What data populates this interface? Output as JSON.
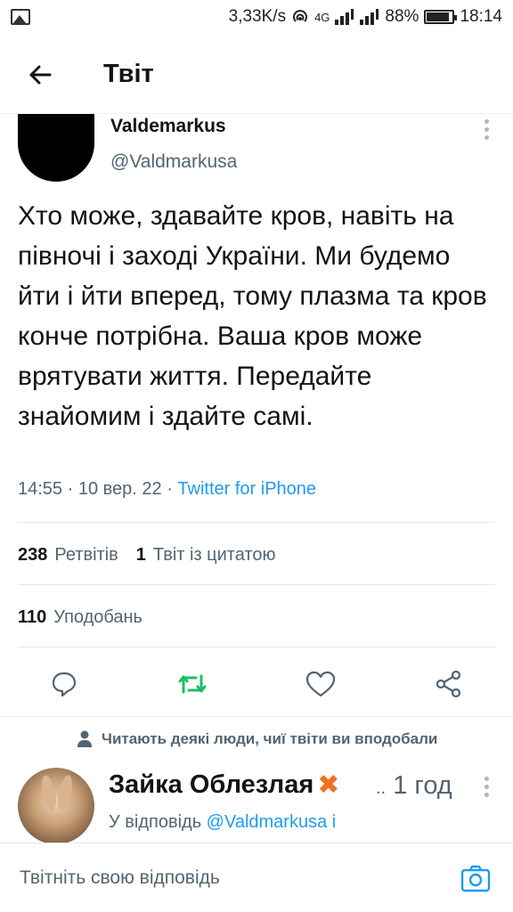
{
  "status_bar": {
    "speed": "3,33K/s",
    "network": "4G",
    "battery": "88%",
    "battery_level": 0.88,
    "time": "18:14"
  },
  "header": {
    "title": "Твіт"
  },
  "tweet": {
    "author_name": "Valdemarkus",
    "author_handle": "@Valdmarkusa",
    "text": "Хто може, здавайте кров, навіть на півночі і заході України. Ми будемо йти і йти вперед, тому плазма та кров конче потрібна. Ваша кров може врятувати життя. Передайте знайомим і здайте самі.",
    "timestamp": "14:55 · 10 вер. 22 · ",
    "source": "Twitter for iPhone",
    "retweets_count": "238",
    "retweets_label": "Ретвітів",
    "quotes_count": "1",
    "quotes_label": "Твіт із цитатою",
    "likes_count": "110",
    "likes_label": "Уподобань"
  },
  "reply_section": {
    "context": "Читають деякі люди, чиї твіти ви вподобали",
    "reply": {
      "author_name": "Зайка Облезлая",
      "author_suffix": "..",
      "time": "1 год",
      "reply_prefix": "У відповідь ",
      "reply_handle": "@Valdmarkusa і"
    }
  },
  "composer": {
    "placeholder": "Твітніть свою відповідь"
  },
  "colors": {
    "accent": "#1d9bf0",
    "retweet_green": "#17bf63",
    "muted": "#536471"
  }
}
